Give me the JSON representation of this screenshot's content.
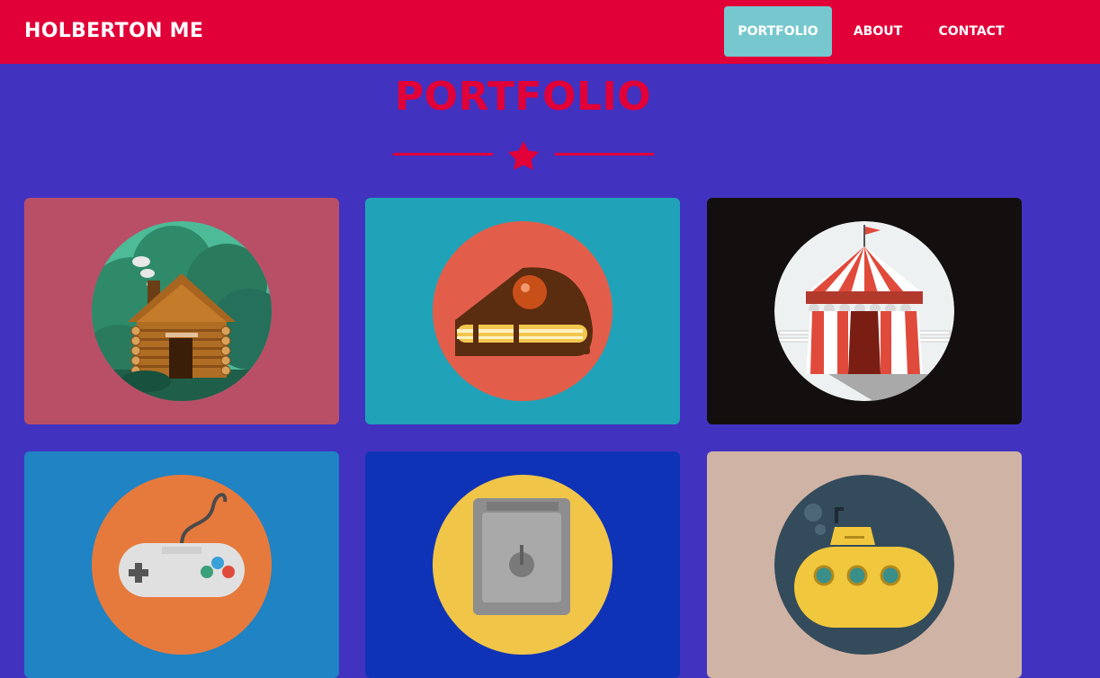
{
  "navbar": {
    "brand": "HOLBERTON ME",
    "items": [
      {
        "label": "PORTFOLIO",
        "active": true
      },
      {
        "label": "ABOUT",
        "active": false
      },
      {
        "label": "CONTACT",
        "active": false
      }
    ]
  },
  "main": {
    "heading": "PORTFOLIO",
    "divider_icon": "star-icon"
  },
  "portfolio": {
    "items": [
      {
        "icon": "log-cabin-icon",
        "background": "#b94f67"
      },
      {
        "icon": "cake-slice-icon",
        "background": "#20a3b8"
      },
      {
        "icon": "circus-tent-icon",
        "background": "#130f0f"
      },
      {
        "icon": "game-controller-icon",
        "background": "#1f83c4"
      },
      {
        "icon": "safe-icon",
        "background": "#0f33b6"
      },
      {
        "icon": "submarine-icon",
        "background": "#cfb3a4"
      }
    ]
  },
  "colors": {
    "page_background": "#4232c0",
    "navbar": "#e10038",
    "active_nav": "#76c8ce",
    "heading": "#e10038"
  }
}
